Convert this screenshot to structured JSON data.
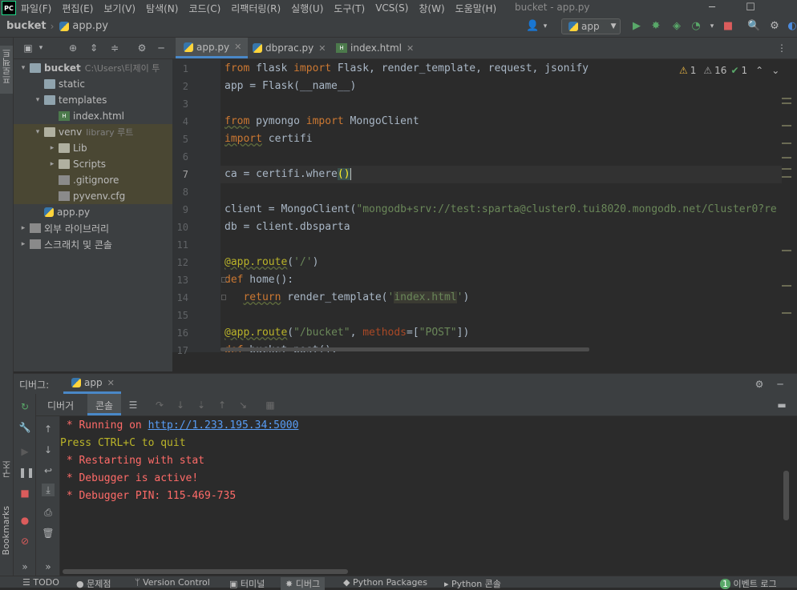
{
  "menu": {
    "logo": "PC",
    "items": [
      "파일(F)",
      "편집(E)",
      "보기(V)",
      "탐색(N)",
      "코드(C)",
      "리팩터링(R)",
      "실행(U)",
      "도구(T)",
      "VCS(S)",
      "창(W)",
      "도움말(H)"
    ],
    "window_title": "bucket - app.py",
    "min": "─",
    "max": "☐"
  },
  "navbar": {
    "project": "bucket",
    "file": "app.py",
    "run_config": "app",
    "icons": [
      "user-icon",
      "run-icon",
      "debug-icon",
      "coverage-icon",
      "profile-icon",
      "stop-icon",
      "search-icon",
      "settings-icon"
    ]
  },
  "left_stripe": {
    "project": "프로젝트",
    "structure": "구조",
    "bookmarks": "Bookmarks"
  },
  "tree": {
    "rows": [
      {
        "label": "bucket",
        "extra": "C:\\Users\\티제이 투",
        "icon": "folder",
        "indent": 0,
        "arrow": "▾",
        "bold": true
      },
      {
        "label": "static",
        "icon": "folder",
        "indent": 1,
        "arrow": ""
      },
      {
        "label": "templates",
        "icon": "folder",
        "indent": 1,
        "arrow": "▾"
      },
      {
        "label": "index.html",
        "icon": "html",
        "indent": 2,
        "arrow": ""
      },
      {
        "label": "venv",
        "extra": "library 루트",
        "icon": "venv",
        "indent": 1,
        "arrow": "▾",
        "hl": true
      },
      {
        "label": "Lib",
        "icon": "venv",
        "indent": 2,
        "arrow": "▸",
        "hl": true
      },
      {
        "label": "Scripts",
        "icon": "venv",
        "indent": 2,
        "arrow": "▸",
        "hl": true
      },
      {
        "label": ".gitignore",
        "icon": "cfg",
        "indent": 2,
        "arrow": "",
        "hl": true
      },
      {
        "label": "pyvenv.cfg",
        "icon": "cfg",
        "indent": 2,
        "arrow": "",
        "hl": true
      },
      {
        "label": "app.py",
        "icon": "py",
        "indent": 1,
        "arrow": ""
      },
      {
        "label": "외부 라이브러리",
        "icon": "lib",
        "indent": 0,
        "arrow": "▸"
      },
      {
        "label": "스크래치 및 콘솔",
        "icon": "scratch",
        "indent": 0,
        "arrow": "▸"
      }
    ]
  },
  "editor_tabs": [
    {
      "label": "app.py",
      "active": true
    },
    {
      "label": "dbprac.py",
      "active": false
    },
    {
      "label": "index.html",
      "active": false
    }
  ],
  "inspections": {
    "warn_a": "1",
    "warn_b": "16",
    "ok": "1"
  },
  "code_lines": [
    {
      "n": "1",
      "html": "<span class='kw'>from</span> flask <span class='kw'>import</span> Flask, render_template, request, jsonify"
    },
    {
      "n": "2",
      "html": "app = Flask(__name__)"
    },
    {
      "n": "3",
      "html": ""
    },
    {
      "n": "4",
      "html": "<span class='kw wavy'>from</span> pymongo <span class='kw'>import</span> MongoClient"
    },
    {
      "n": "5",
      "html": "<span class='kw wavy'>import</span> certifi"
    },
    {
      "n": "6",
      "html": ""
    },
    {
      "n": "7",
      "html": "ca = certifi.where()",
      "current": true
    },
    {
      "n": "8",
      "html": ""
    },
    {
      "n": "9",
      "html": "client = MongoClient(<span class='st'>\"mongodb+srv://test:sparta@cluster0.tui8020.mongodb.net/Cluster0?re</span>"
    },
    {
      "n": "10",
      "html": "db = client.dbsparta"
    },
    {
      "n": "11",
      "html": ""
    },
    {
      "n": "12",
      "html": "<span class='dc wavy'>@app.route</span>(<span class='st'>'/'</span>)"
    },
    {
      "n": "13",
      "html": "<span class='kw'>def</span> home():"
    },
    {
      "n": "14",
      "html": "   <span class='kw wavy'>return</span> render_template(<span class='st'>'<span class=\"strhl\">index.html</span>'</span>)"
    },
    {
      "n": "15",
      "html": ""
    },
    {
      "n": "16",
      "html": "<span class='dc wavy'>@app.route</span>(<span class='st'>\"/bucket\"</span>, <span class='pa'>methods</span>=[<span class='st'>\"POST\"</span>])"
    },
    {
      "n": "17",
      "html": "<span class='kw'>def</span> bucket_post():"
    }
  ],
  "debug": {
    "label": "디버그:",
    "config": "app",
    "tab_debugger": "디버거",
    "tab_console": "콘솔",
    "console_lines": [
      {
        "cls": "red",
        "pre": " * Running on ",
        "link": "http://1.233.195.34:5000"
      },
      {
        "cls": "yel",
        "pre": "Press CTRL+C to quit"
      },
      {
        "cls": "red",
        "pre": " * Restarting with stat"
      },
      {
        "cls": "red",
        "pre": " * Debugger is active!"
      },
      {
        "cls": "red",
        "pre": " * Debugger PIN: 115-469-735"
      }
    ]
  },
  "statusbar": {
    "items": [
      "TODO",
      "문제점",
      "Version Control",
      "터미널",
      "디버그",
      "Python Packages",
      "Python 콘솔"
    ],
    "event_count": "1",
    "event_log": "이벤트 로그"
  }
}
